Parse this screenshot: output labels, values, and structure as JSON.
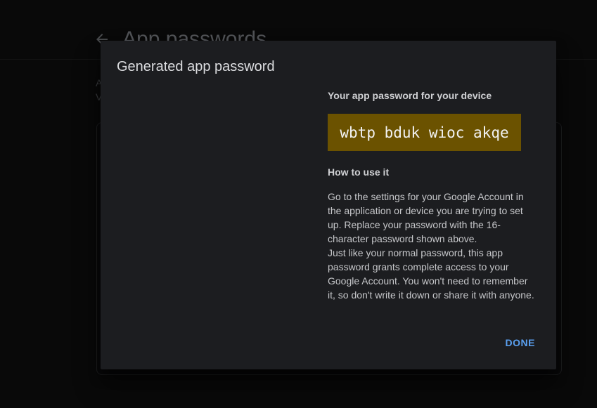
{
  "page": {
    "title": "App passwords",
    "intro_text": "A\nV"
  },
  "dialog": {
    "title": "Generated app password",
    "device_label": "Your app password for your device",
    "password": "wbtp bduk wioc akqe",
    "howto_label": "How to use it",
    "instructions_p1": "Go to the settings for your Google Account in the application or device you are trying to set up. Replace your password with the 16-character password shown above.",
    "instructions_p2": "Just like your normal password, this app password grants complete access to your Google Account. You won't need to remember it, so don't write it down or share it with anyone.",
    "done_label": "DONE"
  },
  "colors": {
    "password_bg": "#6b5200",
    "accent": "#5aa0f0",
    "dialog_bg": "#1c1d20"
  },
  "icons": {
    "back": "back-arrow-icon"
  }
}
